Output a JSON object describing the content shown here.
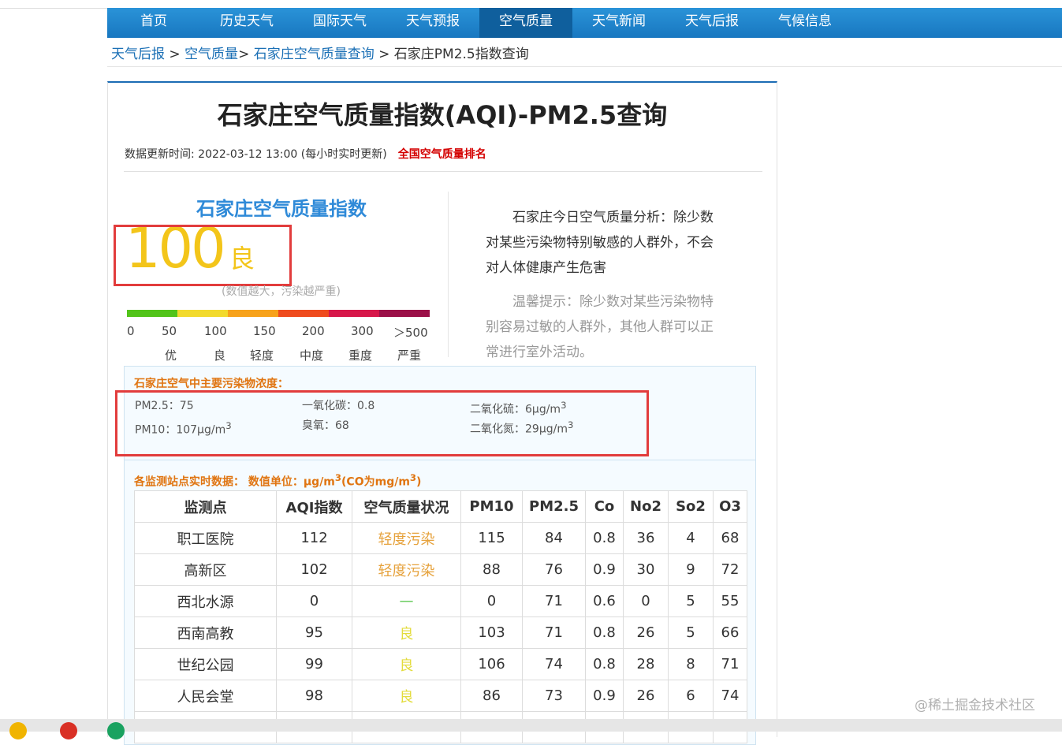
{
  "nav": [
    "首页",
    "历史天气",
    "国际天气",
    "天气预报",
    "空气质量",
    "天气新闻",
    "天气后报",
    "气候信息"
  ],
  "breadcrumb": {
    "link1": "天气后报",
    "sep1": " > ",
    "link2": "空气质量",
    "sep2": "> ",
    "link3": "石家庄空气质量查询",
    "sep3": " > ",
    "current": "石家庄PM2.5指数查询"
  },
  "title": "石家庄空气质量指数(AQI)-PM2.5查询",
  "update_text": "数据更新时间: 2022-03-12 13:00 (每小时实时更新)",
  "rank_link": "全国空气质量排名",
  "aqi": {
    "heading": "石家庄空气质量指数",
    "value": "100",
    "level": "良",
    "note": "(数值越大，污染越严重)",
    "scale_colors": [
      "#52c41a",
      "#f2da2d",
      "#f7a21b",
      "#ef4b1e",
      "#d7174a",
      "#9b1048"
    ],
    "scale_numbers": [
      "0",
      "50",
      "100",
      "150",
      "200",
      "300",
      "＞500"
    ],
    "scale_words": [
      "优",
      "良",
      "轻度",
      "中度",
      "重度",
      "严重"
    ]
  },
  "analysis": "石家庄今日空气质量分析：除少数对某些污染物特别敏感的人群外，不会对人体健康产生危害",
  "tip": "温馨提示：除少数对某些污染物特别容易过敏的人群外，其他人群可以正常进行室外活动。",
  "pollutants": {
    "title": "石家庄空气中主要污染物浓度：",
    "pm25": "PM2.5：75",
    "pm10": "PM10：107μg/m",
    "co": "一氧化碳：0.8",
    "o3": "臭氧：68",
    "so2": "二氧化硫：6μg/m",
    "no2": "二氧化氮：29μg/m",
    "sup": "3"
  },
  "stations": {
    "title_a": "各监测站点实时数据：  数值单位：μg/m",
    "title_sup": "3",
    "title_b": "(CO为mg/m",
    "title_c": ")",
    "headers": [
      "监测点",
      "AQI指数",
      "空气质量状况",
      "PM10",
      "PM2.5",
      "Co",
      "No2",
      "So2",
      "O3"
    ],
    "rows": [
      [
        "职工医院",
        "112",
        "轻度污染",
        "115",
        "84",
        "0.8",
        "36",
        "4",
        "68"
      ],
      [
        "高新区",
        "102",
        "轻度污染",
        "88",
        "76",
        "0.9",
        "30",
        "9",
        "72"
      ],
      [
        "西北水源",
        "0",
        "—",
        "0",
        "71",
        "0.6",
        "0",
        "5",
        "55"
      ],
      [
        "西南高教",
        "95",
        "良",
        "103",
        "71",
        "0.8",
        "26",
        "5",
        "66"
      ],
      [
        "世纪公园",
        "99",
        "良",
        "106",
        "74",
        "0.8",
        "28",
        "8",
        "71"
      ],
      [
        "人民会堂",
        "98",
        "良",
        "86",
        "73",
        "0.9",
        "26",
        "6",
        "74"
      ]
    ]
  },
  "watermark": "@稀土掘金技术社区"
}
